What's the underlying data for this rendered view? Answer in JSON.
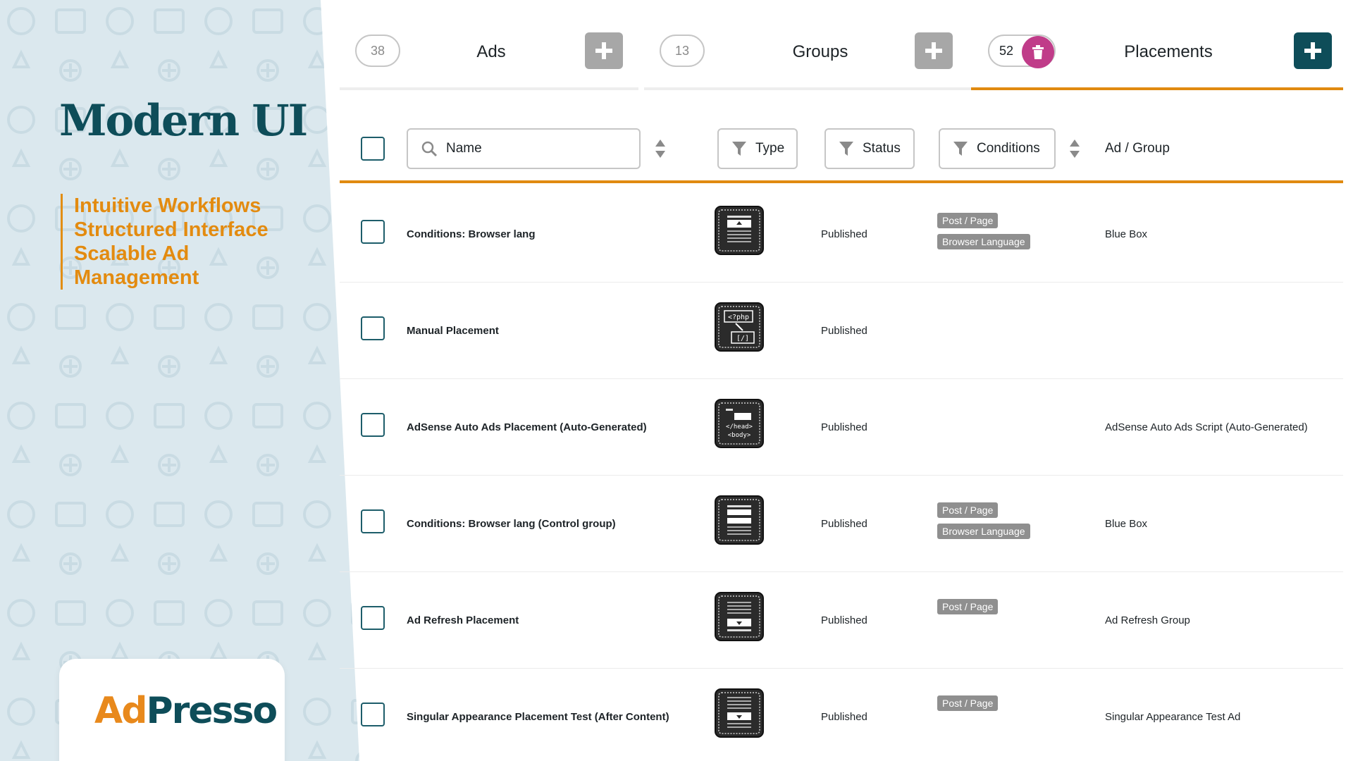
{
  "promo": {
    "title": "Modern UI",
    "taglines": [
      "Intuitive Workflows",
      "Structured Interface",
      "Scalable Ad",
      "Management"
    ],
    "brand_part1": "Ad",
    "brand_part2": "Presso"
  },
  "tabs": [
    {
      "count": "38",
      "label": "Ads",
      "active": false
    },
    {
      "count": "13",
      "label": "Groups",
      "active": false
    },
    {
      "count": "52",
      "label": "Placements",
      "active": true
    }
  ],
  "table": {
    "header": {
      "name_placeholder": "Name",
      "type_label": "Type",
      "status_label": "Status",
      "conditions_label": "Conditions",
      "adgroup_label": "Ad / Group"
    },
    "rows": [
      {
        "name": "Conditions: Browser lang",
        "type_icon": "placement-header-icon",
        "status": "Published",
        "conditions": [
          "Post / Page",
          "Browser Language"
        ],
        "ad_group": "Blue Box"
      },
      {
        "name": "Manual Placement",
        "type_icon": "placement-php-icon",
        "status": "Published",
        "conditions": [],
        "ad_group": ""
      },
      {
        "name": "AdSense Auto Ads Placement (Auto-Generated)",
        "type_icon": "placement-head-body-icon",
        "status": "Published",
        "conditions": [],
        "ad_group": "AdSense Auto Ads Script (Auto-Generated)"
      },
      {
        "name": "Conditions: Browser lang (Control group)",
        "type_icon": "placement-header-icon",
        "status": "Published",
        "conditions": [
          "Post / Page",
          "Browser Language"
        ],
        "ad_group": "Blue Box"
      },
      {
        "name": "Ad Refresh Placement",
        "type_icon": "placement-footer-icon",
        "status": "Published",
        "conditions": [
          "Post / Page"
        ],
        "ad_group": "Ad Refresh Group"
      },
      {
        "name": "Singular Appearance Placement Test (After Content)",
        "type_icon": "placement-after-content-icon",
        "status": "Published",
        "conditions": [
          "Post / Page"
        ],
        "ad_group": "Singular Appearance Test Ad"
      }
    ]
  },
  "colors": {
    "accent": "#e08a10",
    "brand_teal": "#0e4d59",
    "trash": "#c03c89",
    "tag_bg": "#8f8f8f"
  }
}
